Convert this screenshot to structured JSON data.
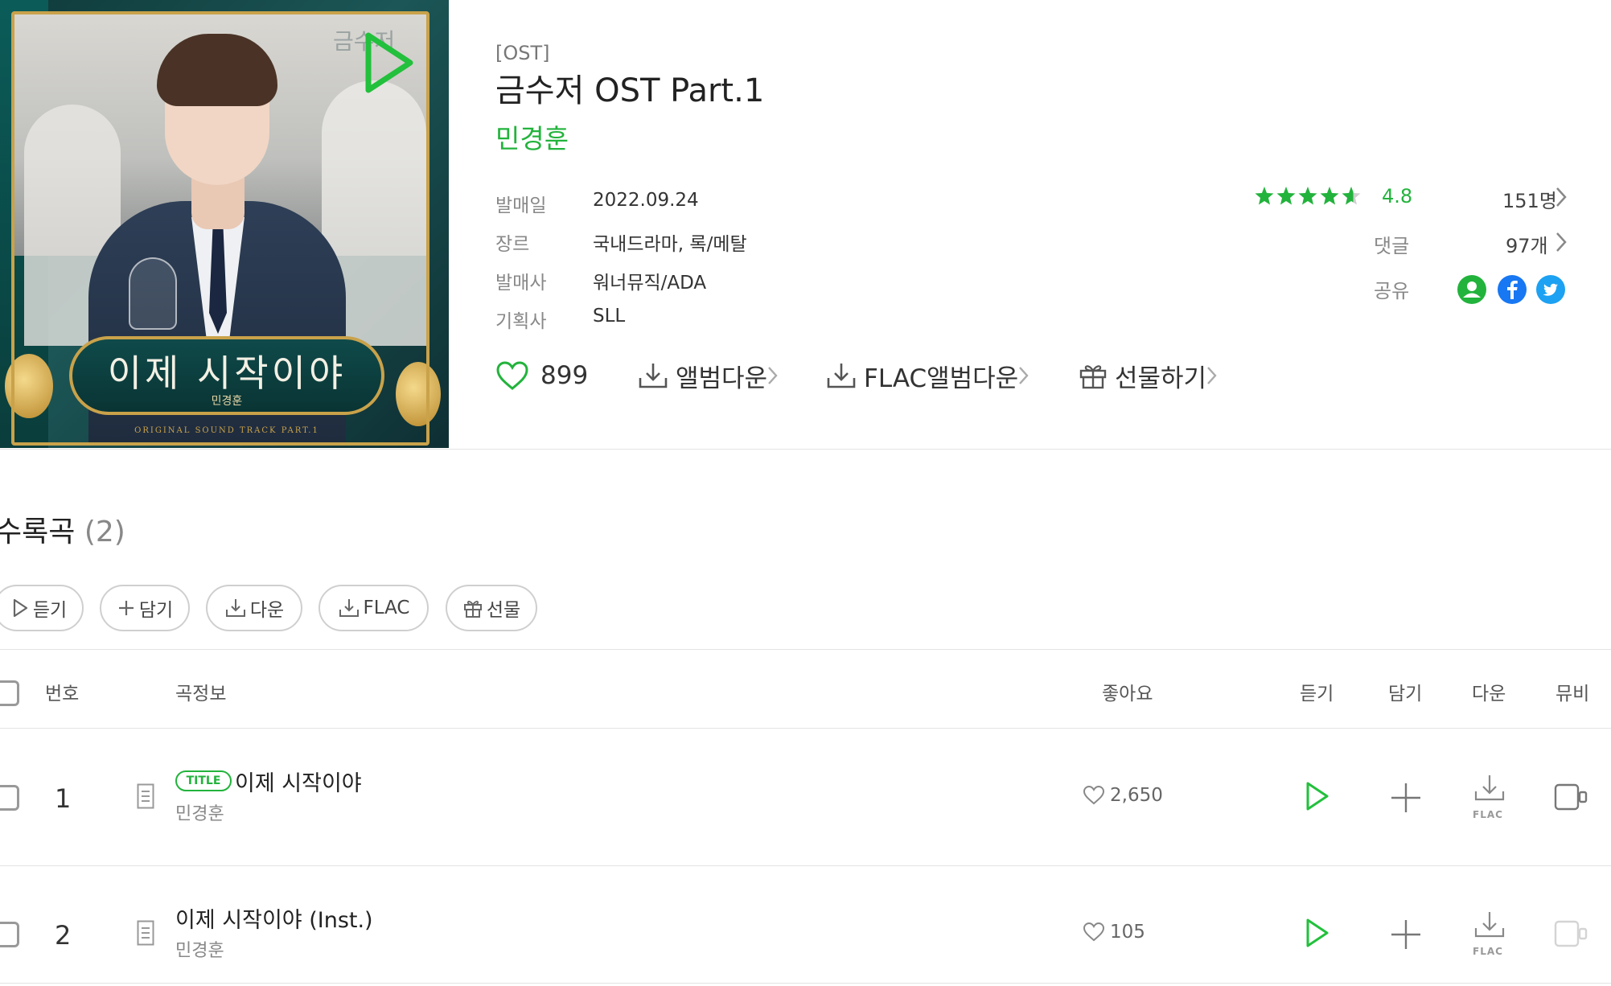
{
  "album": {
    "cover_logo": "금수저",
    "cover_title": "이제 시작이야",
    "cover_artist": "민경훈",
    "cover_ost": "ORIGINAL SOUND TRACK PART.1",
    "type_tag": "[OST]",
    "title": "금수저 OST Part.1",
    "artist": "민경훈"
  },
  "meta": [
    {
      "label": "발매일",
      "value": "2022.09.24"
    },
    {
      "label": "장르",
      "value": "국내드라마, 록/메탈"
    },
    {
      "label": "발매사",
      "value": "워너뮤직/ADA"
    },
    {
      "label": "기획사",
      "value": "SLL"
    }
  ],
  "rating": {
    "stars": 4.8,
    "score": "4.8",
    "count": "151명"
  },
  "comments": {
    "label": "댓글",
    "count": "97개"
  },
  "share": {
    "label": "공유",
    "services": [
      "profile-icon",
      "facebook-icon",
      "twitter-icon"
    ]
  },
  "actions": {
    "likes": "899",
    "album_down": "앨범다운",
    "flac_down": "FLAC앨범다운",
    "gift": "선물하기"
  },
  "tracklist": {
    "title": "수록곡",
    "count": "(2)",
    "buttons": {
      "listen": "듣기",
      "add": "담기",
      "down": "다운",
      "flac": "FLAC",
      "gift": "선물"
    },
    "headers": {
      "no": "번호",
      "info": "곡정보",
      "likes": "좋아요",
      "listen": "듣기",
      "add": "담기",
      "down": "다운",
      "mv": "뮤비"
    },
    "flac_label": "FLAC",
    "tracks": [
      {
        "no": "1",
        "badge": "TITLE",
        "title": "이제 시작이야",
        "artist": "민경훈",
        "likes": "2,650",
        "mv_available": true
      },
      {
        "no": "2",
        "badge": "",
        "title": "이제 시작이야 (Inst.)",
        "artist": "민경훈",
        "likes": "105",
        "mv_available": false
      }
    ]
  },
  "colors": {
    "accent": "#22b33c",
    "twitter": "#1da1f2",
    "facebook": "#1877f2"
  }
}
